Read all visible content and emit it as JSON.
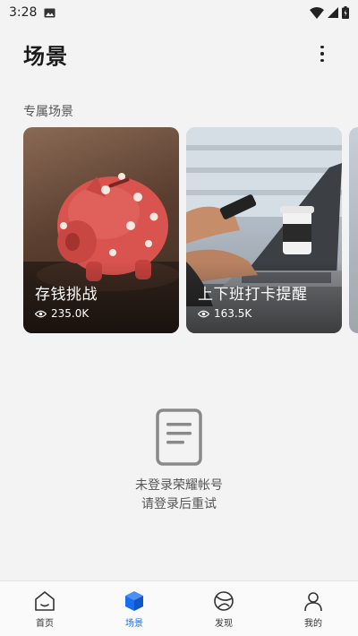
{
  "status_bar": {
    "time": "3:28"
  },
  "header": {
    "title": "场景"
  },
  "section": {
    "title": "专属场景"
  },
  "cards": [
    {
      "title": "存钱挑战",
      "views": "235.0K"
    },
    {
      "title": "上下班打卡提醒",
      "views": "163.5K"
    }
  ],
  "empty_state": {
    "line1": "未登录荣耀帐号",
    "line2": "请登录后重试"
  },
  "nav": {
    "items": [
      {
        "label": "首页",
        "icon": "home-icon",
        "active": false
      },
      {
        "label": "场景",
        "icon": "cube-icon",
        "active": true
      },
      {
        "label": "发现",
        "icon": "compass-icon",
        "active": false
      },
      {
        "label": "我的",
        "icon": "user-icon",
        "active": false
      }
    ]
  },
  "colors": {
    "accent": "#1a6df0",
    "background": "#f3f3f3"
  }
}
